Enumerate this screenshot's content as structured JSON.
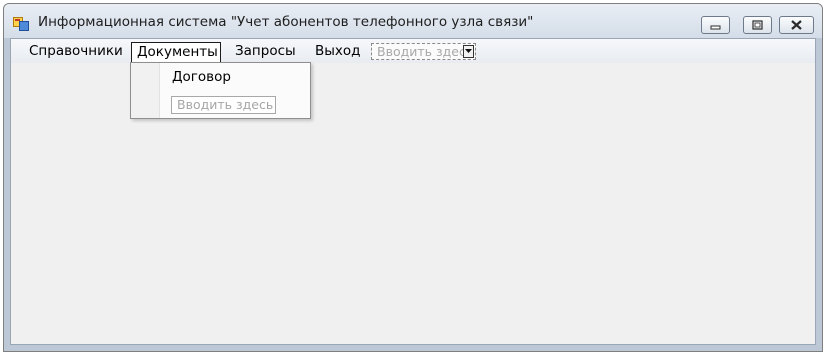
{
  "window": {
    "title": "Информационная система \"Учет абонентов телефонного узла связи\"",
    "icon": "app-form-icon",
    "controls": [
      "minimize-icon",
      "maximize-icon",
      "close-icon"
    ]
  },
  "menubar": {
    "items": [
      {
        "label": "Справочники"
      },
      {
        "label": "Документы",
        "state": "open"
      },
      {
        "label": "Запросы"
      },
      {
        "label": "Выход"
      }
    ],
    "type_here": "Вводить здесь"
  },
  "dropdown": {
    "items": [
      {
        "label": "Договор"
      }
    ],
    "type_here": "Вводить здесь"
  }
}
